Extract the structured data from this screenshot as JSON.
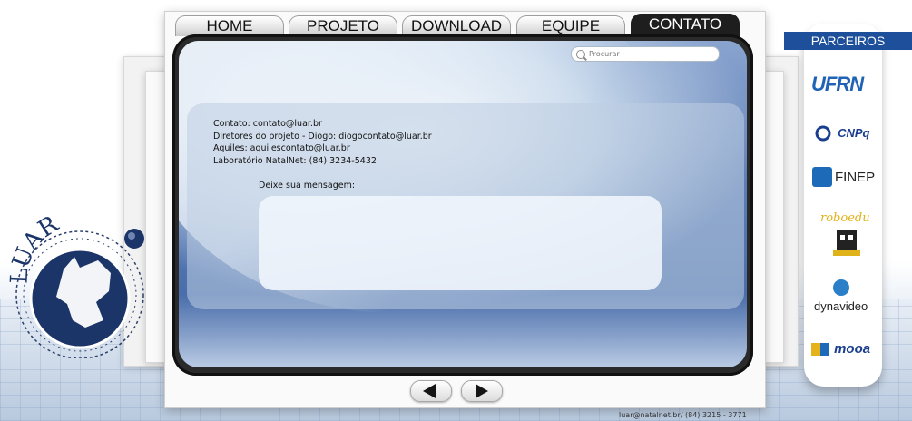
{
  "nav": {
    "tabs": [
      {
        "label": "HOME",
        "active": false
      },
      {
        "label": "PROJETO",
        "active": false
      },
      {
        "label": "DOWNLOAD",
        "active": false
      },
      {
        "label": "EQUIPE",
        "active": false
      },
      {
        "label": "CONTATO",
        "active": true
      }
    ]
  },
  "search": {
    "placeholder": "Procurar"
  },
  "contact": {
    "line1": "Contato: contato@luar.br",
    "line2": "Diretores do projeto - Diogo: diogocontato@luar.br",
    "line3": "Aquiles: aquilescontato@luar.br",
    "line4": "Laboratório NatalNet: (84) 3234-5432",
    "message_label": "Deixe sua mensagem:",
    "message_value": ""
  },
  "logo": {
    "text": "LUAR"
  },
  "footer": {
    "text": "luar@natalnet.br/ (84) 3215 - 3771"
  },
  "partners": {
    "title": "PARCEIROS",
    "items": [
      {
        "name": "UFRN",
        "icon": "ufrn-logo"
      },
      {
        "name": "CNPq",
        "icon": "cnpq-logo"
      },
      {
        "name": "FINEP",
        "icon": "finep-logo"
      },
      {
        "name": "roboedu",
        "icon": "roboedu-logo"
      },
      {
        "name": "dynavideo",
        "icon": "dynavideo-logo"
      },
      {
        "name": "mooa",
        "icon": "mooa-logo"
      }
    ]
  },
  "colors": {
    "accent": "#1d4f9a",
    "active_tab": "#1e1e1e",
    "screen": "#5e7fb6"
  }
}
